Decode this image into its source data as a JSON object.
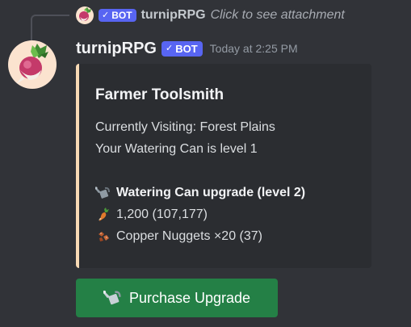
{
  "reply": {
    "username": "turnipRPG",
    "badge_check": "✓",
    "badge_label": "BOT",
    "text": "Click to see attachment"
  },
  "message": {
    "username": "turnipRPG",
    "badge_check": "✓",
    "badge_label": "BOT",
    "timestamp": "Today at 2:25 PM"
  },
  "embed": {
    "accent_color": "#f8dab5",
    "title": "Farmer Toolsmith",
    "visiting": "Currently Visiting: Forest Plains",
    "tool_level": "Your Watering Can is level 1",
    "upgrade_title": "Watering Can upgrade (level 2)",
    "upgrade_icon": "watering-can-icon",
    "cost_icon": "turnip-coin-icon",
    "cost": "1,200 (107,177)",
    "material_icon": "copper-nugget-icon",
    "material": "Copper Nuggets ×20 (37)"
  },
  "button": {
    "label": "Purchase Upgrade",
    "icon": "watering-can-icon",
    "color": "#248046"
  }
}
